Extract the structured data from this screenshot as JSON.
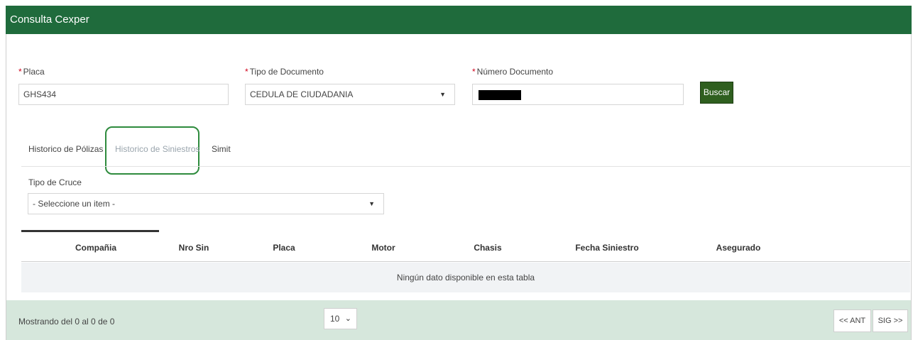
{
  "window": {
    "title": "Consulta Cexper"
  },
  "form": {
    "required_mark": "*",
    "placa": {
      "label": "Placa",
      "value": "GHS434"
    },
    "tipo_documento": {
      "label": "Tipo de Documento",
      "value": "CEDULA DE CIUDADANIA"
    },
    "numero_documento": {
      "label": "Número Documento",
      "value": ""
    },
    "search_button": "Buscar"
  },
  "tabs": [
    {
      "label": "Historico de Pólizas",
      "active": false
    },
    {
      "label": "Historico de Siniestros",
      "active": true
    },
    {
      "label": "Simit",
      "active": false
    }
  ],
  "filter": {
    "label": "Tipo de Cruce",
    "value": "- Seleccione un item -"
  },
  "table": {
    "columns": [
      "Compañia",
      "Nro Sin",
      "Placa",
      "Motor",
      "Chasis",
      "Fecha Siniestro",
      "Asegurado"
    ],
    "empty_message": "Ningún dato disponible en esta tabla"
  },
  "footer": {
    "info": "Mostrando del 0 al 0 de 0",
    "page_size": "10",
    "prev_label": "<< ANT",
    "next_label": "SIG >>"
  },
  "colors": {
    "header": "#1f6b3c",
    "button": "#2f5f1f",
    "footer": "#d6e7dc",
    "highlight": "#2e8b3d",
    "required": "#d0021b"
  }
}
